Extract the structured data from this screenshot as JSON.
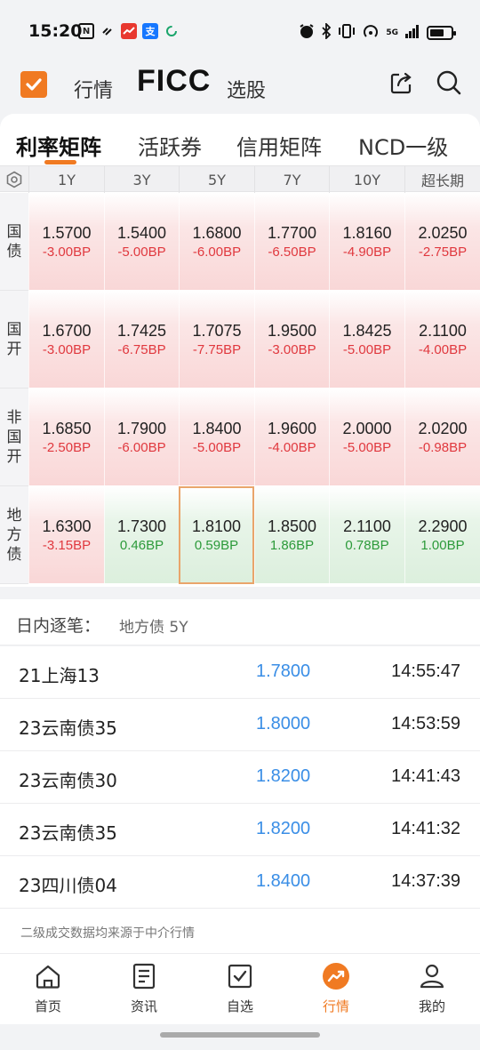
{
  "status_bar": {
    "time": "15:20",
    "network": "5G"
  },
  "header": {
    "tabs": [
      {
        "label": "行情"
      },
      {
        "label": "FICC"
      },
      {
        "label": "选股"
      }
    ]
  },
  "subtabs": [
    {
      "label": "利率矩阵"
    },
    {
      "label": "活跃券"
    },
    {
      "label": "信用矩阵"
    },
    {
      "label": "NCD一级"
    }
  ],
  "matrix": {
    "columns": [
      "1Y",
      "3Y",
      "5Y",
      "7Y",
      "10Y",
      "超长期"
    ],
    "rows": [
      {
        "label": [
          "国",
          "债"
        ],
        "cells": [
          {
            "yield": "1.5700",
            "change": "-3.00BP"
          },
          {
            "yield": "1.5400",
            "change": "-5.00BP"
          },
          {
            "yield": "1.6800",
            "change": "-6.00BP"
          },
          {
            "yield": "1.7700",
            "change": "-6.50BP"
          },
          {
            "yield": "1.8160",
            "change": "-4.90BP"
          },
          {
            "yield": "2.0250",
            "change": "-2.75BP"
          }
        ]
      },
      {
        "label": [
          "国",
          "开"
        ],
        "cells": [
          {
            "yield": "1.6700",
            "change": "-3.00BP"
          },
          {
            "yield": "1.7425",
            "change": "-6.75BP"
          },
          {
            "yield": "1.7075",
            "change": "-7.75BP"
          },
          {
            "yield": "1.9500",
            "change": "-3.00BP"
          },
          {
            "yield": "1.8425",
            "change": "-5.00BP"
          },
          {
            "yield": "2.1100",
            "change": "-4.00BP"
          }
        ]
      },
      {
        "label": [
          "非",
          "国",
          "开"
        ],
        "cells": [
          {
            "yield": "1.6850",
            "change": "-2.50BP"
          },
          {
            "yield": "1.7900",
            "change": "-6.00BP"
          },
          {
            "yield": "1.8400",
            "change": "-5.00BP"
          },
          {
            "yield": "1.9600",
            "change": "-4.00BP"
          },
          {
            "yield": "2.0000",
            "change": "-5.00BP"
          },
          {
            "yield": "2.0200",
            "change": "-0.98BP"
          }
        ]
      },
      {
        "label": [
          "地",
          "方",
          "债"
        ],
        "cells": [
          {
            "yield": "1.6300",
            "change": "-3.15BP"
          },
          {
            "yield": "1.7300",
            "change": "0.46BP"
          },
          {
            "yield": "1.8100",
            "change": "0.59BP"
          },
          {
            "yield": "1.8500",
            "change": "1.86BP"
          },
          {
            "yield": "2.1100",
            "change": "0.78BP"
          },
          {
            "yield": "2.2900",
            "change": "1.00BP"
          }
        ]
      }
    ]
  },
  "intraday": {
    "title": "日内逐笔：",
    "selection": "地方债 5Y",
    "trades": [
      {
        "name": "21上海13",
        "yield": "1.7800",
        "time": "14:55:47"
      },
      {
        "name": "23云南债35",
        "yield": "1.8000",
        "time": "14:53:59"
      },
      {
        "name": "23云南债30",
        "yield": "1.8200",
        "time": "14:41:43"
      },
      {
        "name": "23云南债35",
        "yield": "1.8200",
        "time": "14:41:32"
      },
      {
        "name": "23四川债04",
        "yield": "1.8400",
        "time": "14:37:39"
      }
    ],
    "source_note": "二级成交数据均来源于中介行情"
  },
  "bottom_nav": [
    {
      "label": "首页",
      "icon": "home-icon"
    },
    {
      "label": "资讯",
      "icon": "news-icon"
    },
    {
      "label": "自选",
      "icon": "checkbox-icon"
    },
    {
      "label": "行情",
      "icon": "trend-icon"
    },
    {
      "label": "我的",
      "icon": "user-icon"
    }
  ],
  "colors": {
    "accent": "#f07a22",
    "down": "#e0383e",
    "up": "#2c9a3a",
    "link_blue": "#3a8ee6"
  }
}
